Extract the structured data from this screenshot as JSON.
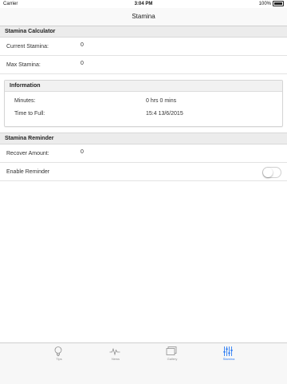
{
  "status_bar": {
    "carrier": "Carrier",
    "time": "3:04 PM",
    "battery": "100%"
  },
  "navbar": {
    "title": "Stamina"
  },
  "calculator": {
    "header": "Stamina Calculator",
    "rows": [
      {
        "label": "Current Stamina:",
        "value": "0"
      },
      {
        "label": "Max Stamina:",
        "value": "0"
      }
    ]
  },
  "information": {
    "header": "Information",
    "rows": [
      {
        "label": "Minutes:",
        "value": "0 hrs 0 mins"
      },
      {
        "label": "Time to Full:",
        "value": "15:4 13/6/2015"
      }
    ]
  },
  "reminder": {
    "header": "Stamina Reminder",
    "recover_label": "Recover Amount:",
    "recover_value": "0",
    "enable_label": "Enable Reminder",
    "enabled": false
  },
  "tabbar": {
    "active_color": "#2b7bf3",
    "tabs": [
      {
        "label": "Tips",
        "icon": "lightbulb-icon"
      },
      {
        "label": "News",
        "icon": "pulse-icon"
      },
      {
        "label": "Gallery",
        "icon": "gallery-icon"
      },
      {
        "label": "Stamina",
        "icon": "sliders-icon",
        "active": true
      }
    ]
  }
}
